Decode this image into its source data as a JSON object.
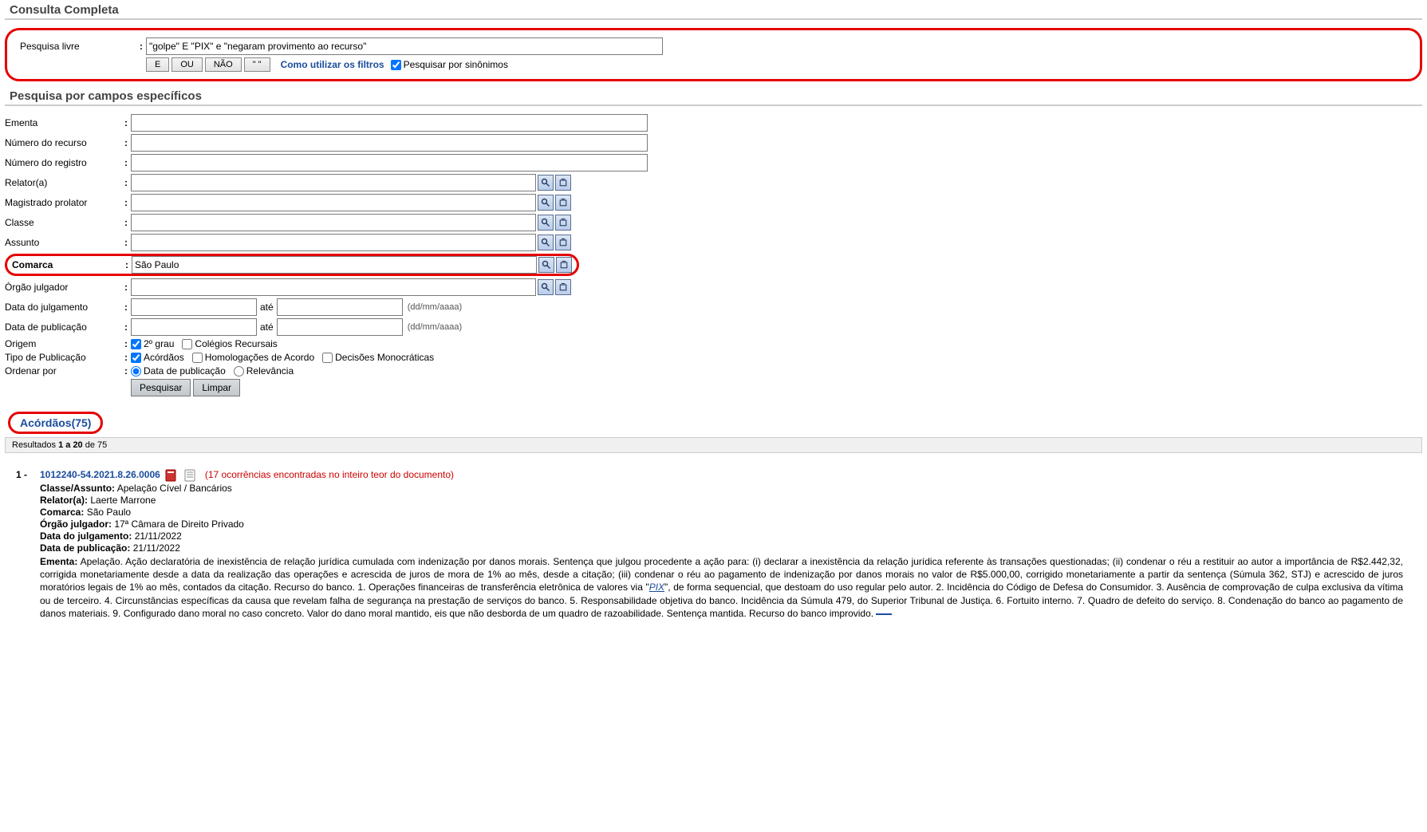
{
  "titles": {
    "consulta_completa": "Consulta Completa",
    "pesquisa_campos": "Pesquisa por campos específicos"
  },
  "free_search": {
    "label": "Pesquisa livre",
    "value": "\"golpe\" E \"PIX\" e \"negaram provimento ao recurso\"",
    "btn_e": "E",
    "btn_ou": "OU",
    "btn_nao": "NÃO",
    "btn_quotes": "\" \"",
    "help": "Como utilizar os filtros",
    "synonyms_label": "Pesquisar por sinônimos",
    "synonyms_checked": true
  },
  "fields": {
    "ementa": {
      "label": "Ementa",
      "value": ""
    },
    "num_recurso": {
      "label": "Número do recurso",
      "value": ""
    },
    "num_registro": {
      "label": "Número do registro",
      "value": ""
    },
    "relator": {
      "label": "Relator(a)",
      "value": ""
    },
    "magistrado": {
      "label": "Magistrado prolator",
      "value": ""
    },
    "classe": {
      "label": "Classe",
      "value": ""
    },
    "assunto": {
      "label": "Assunto",
      "value": ""
    },
    "comarca": {
      "label": "Comarca",
      "value": "São Paulo"
    },
    "orgao": {
      "label": "Órgão julgador",
      "value": ""
    },
    "data_julg": {
      "label": "Data do julgamento",
      "from": "",
      "to": "",
      "hint": "(dd/mm/aaaa)",
      "ate": "até"
    },
    "data_pub": {
      "label": "Data de publicação",
      "from": "",
      "to": "",
      "hint": "(dd/mm/aaaa)",
      "ate": "até"
    },
    "origem": {
      "label": "Origem",
      "opt1": "2º grau",
      "opt1_checked": true,
      "opt2": "Colégios Recursais",
      "opt2_checked": false
    },
    "tipo_pub": {
      "label": "Tipo de Publicação",
      "o1": "Acórdãos",
      "o1c": true,
      "o2": "Homologações de Acordo",
      "o2c": false,
      "o3": "Decisões Monocráticas",
      "o3c": false
    },
    "ordenar": {
      "label": "Ordenar por",
      "o1": "Data de publicação",
      "o2": "Relevância",
      "sel": "o1"
    }
  },
  "buttons": {
    "pesquisar": "Pesquisar",
    "limpar": "Limpar"
  },
  "results": {
    "tab": "Acórdãos(75)",
    "bar_pre": "Resultados ",
    "bar_range": "1 a 20",
    "bar_post": " de 75",
    "item": {
      "idx": "1 -",
      "proc": "1012240-54.2021.8.26.0006",
      "occ": "(17 ocorrências encontradas no inteiro teor do documento)",
      "classe_lbl": "Classe/Assunto:",
      "classe": "Apelação Cível / Bancários",
      "relator_lbl": "Relator(a):",
      "relator": "Laerte Marrone",
      "comarca_lbl": "Comarca:",
      "comarca": "São Paulo",
      "orgao_lbl": "Órgão julgador:",
      "orgao": "17ª Câmara de Direito Privado",
      "dj_lbl": "Data do julgamento:",
      "dj": "21/11/2022",
      "dp_lbl": "Data de publicação:",
      "dp": "21/11/2022",
      "ementa_lbl": "Ementa:",
      "ementa_a": "Apelação. Ação declaratória de inexistência de relação jurídica cumulada com indenização por danos morais. Sentença que julgou procedente a ação para: (i) declarar a inexistência da relação jurídica referente às transações questionadas; (ii) condenar o réu a restituir ao autor a importância de R$2.442,32, corrigida monetariamente desde a data da realização das operações e acrescida de juros de mora de 1% ao mês, desde a citação; (iii) condenar o réu ao pagamento de indenização por danos morais no valor de R$5.000,00, corrigido monetariamente a partir da sentença (Súmula 362, STJ) e acrescido de juros moratórios legais de 1% ao mês, contados da citação. Recurso do banco. 1. Operações financeiras de transferência eletrônica de valores via \"",
      "ementa_pix": "PIX",
      "ementa_b": "\", de forma sequencial, que destoam do uso regular pelo autor. 2. Incidência do Código de Defesa do Consumidor. 3. Ausência de comprovação de culpa exclusiva da vítima ou de terceiro. 4. Circunstâncias específicas da causa que revelam falha de segurança na prestação de serviços do banco. 5. Responsabilidade objetiva do banco. Incidência da Súmula 479, do Superior Tribunal de Justiça. 6. Fortuito interno. 7. Quadro de defeito do serviço. 8. Condenação do banco ao pagamento de danos materiais. 9. Configurado dano moral no caso concreto. Valor do dano moral mantido, eis que não desborda de um quadro de razoabilidade. Sentença mantida. Recurso do banco improvido. "
    }
  }
}
